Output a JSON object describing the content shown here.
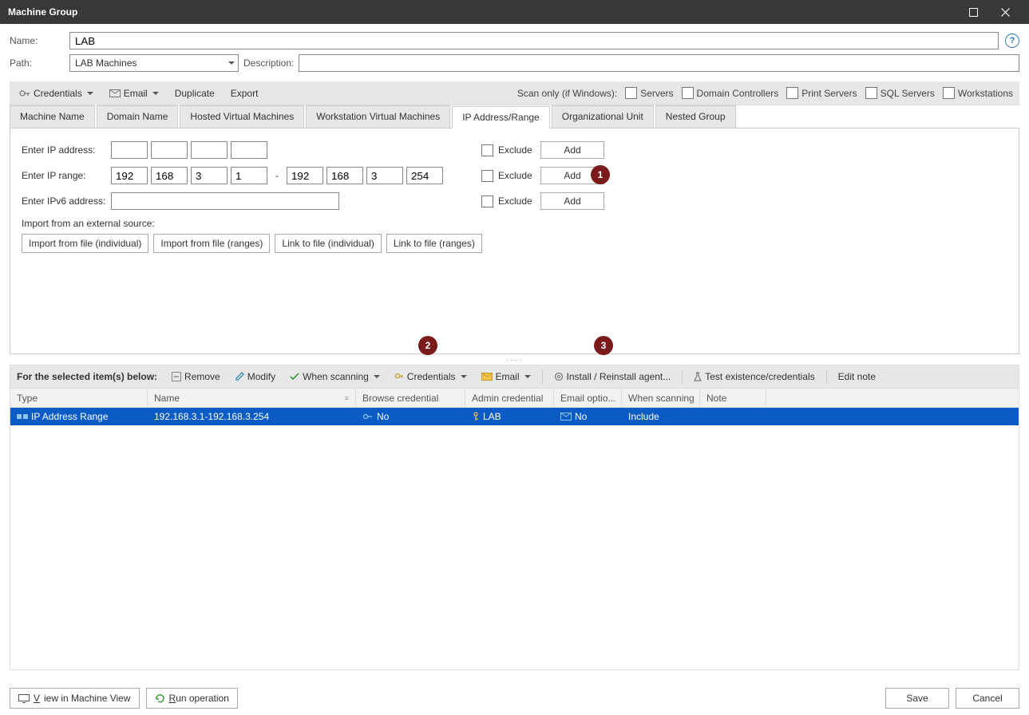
{
  "window": {
    "title": "Machine Group"
  },
  "form": {
    "name_label": "Name:",
    "name_value": "LAB",
    "path_label": "Path:",
    "path_value": "LAB Machines",
    "description_label": "Description:",
    "description_value": ""
  },
  "toolbar1": {
    "credentials": "Credentials",
    "email": "Email",
    "duplicate": "Duplicate",
    "export": "Export",
    "scan_only_label": "Scan only (if Windows):",
    "servers": "Servers",
    "domain_controllers": "Domain Controllers",
    "print_servers": "Print Servers",
    "sql_servers": "SQL Servers",
    "workstations": "Workstations"
  },
  "tabs": {
    "machine_name": "Machine Name",
    "domain_name": "Domain Name",
    "hosted_vm": "Hosted Virtual Machines",
    "workstation_vm": "Workstation Virtual Machines",
    "ip_range": "IP Address/Range",
    "ou": "Organizational Unit",
    "nested": "Nested Group"
  },
  "ip_panel": {
    "enter_ip": "Enter IP address:",
    "enter_range": "Enter IP range:",
    "enter_ipv6": "Enter IPv6 address:",
    "exclude": "Exclude",
    "add": "Add",
    "range_start": {
      "a": "192",
      "b": "168",
      "c": "3",
      "d": "1"
    },
    "range_end": {
      "a": "192",
      "b": "168",
      "c": "3",
      "d": "254"
    },
    "import_label": "Import from an external source:",
    "import_file_ind": "Import from file (individual)",
    "import_file_rng": "Import from file (ranges)",
    "link_file_ind": "Link to file (individual)",
    "link_file_rng": "Link to file (ranges)"
  },
  "toolbar2": {
    "label": "For the selected item(s) below:",
    "remove": "Remove",
    "modify": "Modify",
    "when_scanning": "When scanning",
    "credentials": "Credentials",
    "email": "Email",
    "install_agent": "Install / Reinstall agent...",
    "test": "Test existence/credentials",
    "edit_note": "Edit note"
  },
  "grid": {
    "headers": {
      "type": "Type",
      "name": "Name",
      "browse": "Browse credential",
      "admin": "Admin credential",
      "email": "Email optio...",
      "when": "When scanning",
      "note": "Note"
    },
    "row": {
      "type": "IP Address Range",
      "name": "192.168.3.1-192.168.3.254",
      "browse": "No",
      "admin": "LAB",
      "email": "No",
      "when": "Include",
      "note": ""
    }
  },
  "footer": {
    "view_machine": "View in Machine View",
    "run_op": "Run operation",
    "save": "Save",
    "cancel": "Cancel"
  },
  "badges": {
    "b1": "1",
    "b2": "2",
    "b3": "3"
  }
}
